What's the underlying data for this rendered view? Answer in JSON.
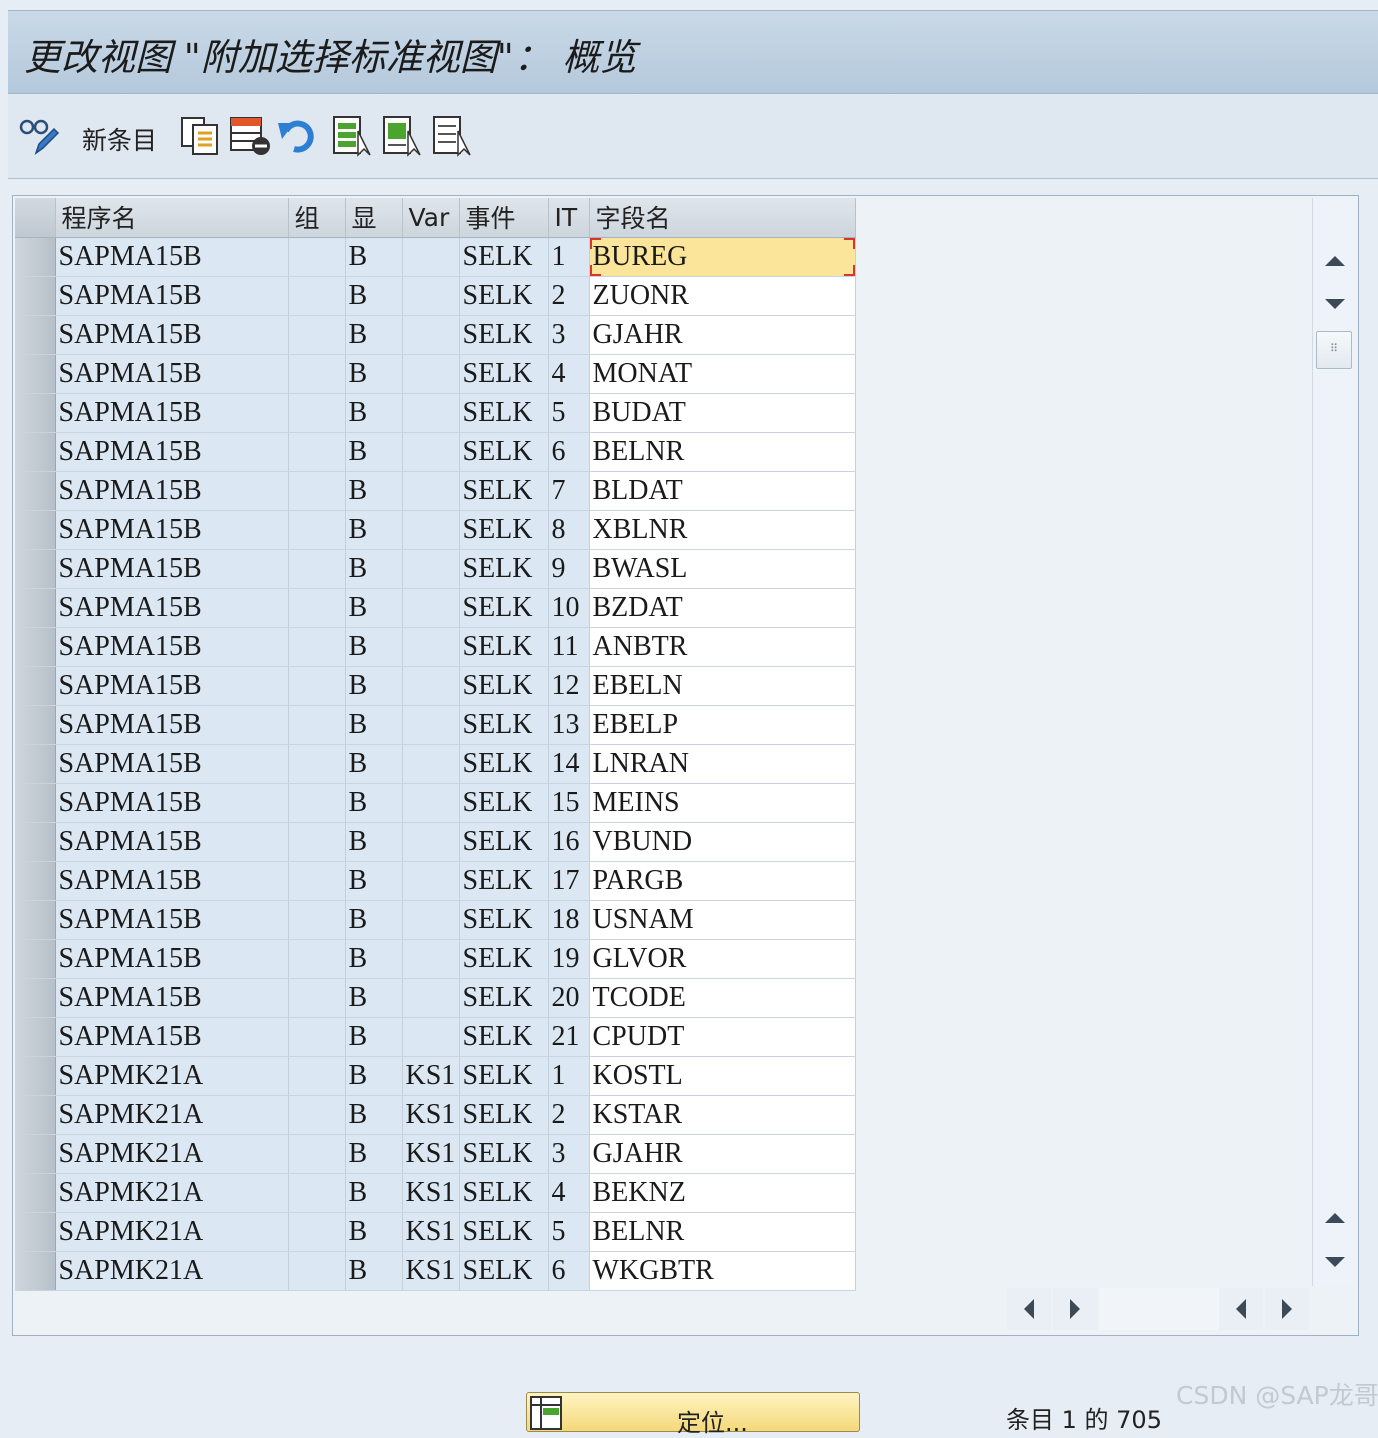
{
  "window": {
    "title": "更改视图 \"附加选择标准视图\"： 概览"
  },
  "toolbar": {
    "new_entry_label": "新条目",
    "icons": [
      "display-change-icon",
      "copy-icon",
      "delete-icon",
      "undo-icon",
      "select-all-icon",
      "select-block-icon",
      "deselect-all-icon"
    ]
  },
  "table": {
    "columns": [
      "程序名",
      "组",
      "显",
      "Var",
      "事件",
      "IT",
      "字段名"
    ],
    "rows": [
      {
        "program": "SAPMA15B",
        "group": "",
        "disp": "B",
        "var": "",
        "event": "SELK",
        "it": "1",
        "field": "BUREG"
      },
      {
        "program": "SAPMA15B",
        "group": "",
        "disp": "B",
        "var": "",
        "event": "SELK",
        "it": "2",
        "field": "ZUONR"
      },
      {
        "program": "SAPMA15B",
        "group": "",
        "disp": "B",
        "var": "",
        "event": "SELK",
        "it": "3",
        "field": "GJAHR"
      },
      {
        "program": "SAPMA15B",
        "group": "",
        "disp": "B",
        "var": "",
        "event": "SELK",
        "it": "4",
        "field": "MONAT"
      },
      {
        "program": "SAPMA15B",
        "group": "",
        "disp": "B",
        "var": "",
        "event": "SELK",
        "it": "5",
        "field": "BUDAT"
      },
      {
        "program": "SAPMA15B",
        "group": "",
        "disp": "B",
        "var": "",
        "event": "SELK",
        "it": "6",
        "field": "BELNR"
      },
      {
        "program": "SAPMA15B",
        "group": "",
        "disp": "B",
        "var": "",
        "event": "SELK",
        "it": "7",
        "field": "BLDAT"
      },
      {
        "program": "SAPMA15B",
        "group": "",
        "disp": "B",
        "var": "",
        "event": "SELK",
        "it": "8",
        "field": "XBLNR"
      },
      {
        "program": "SAPMA15B",
        "group": "",
        "disp": "B",
        "var": "",
        "event": "SELK",
        "it": "9",
        "field": "BWASL"
      },
      {
        "program": "SAPMA15B",
        "group": "",
        "disp": "B",
        "var": "",
        "event": "SELK",
        "it": "10",
        "field": "BZDAT"
      },
      {
        "program": "SAPMA15B",
        "group": "",
        "disp": "B",
        "var": "",
        "event": "SELK",
        "it": "11",
        "field": "ANBTR"
      },
      {
        "program": "SAPMA15B",
        "group": "",
        "disp": "B",
        "var": "",
        "event": "SELK",
        "it": "12",
        "field": "EBELN"
      },
      {
        "program": "SAPMA15B",
        "group": "",
        "disp": "B",
        "var": "",
        "event": "SELK",
        "it": "13",
        "field": "EBELP"
      },
      {
        "program": "SAPMA15B",
        "group": "",
        "disp": "B",
        "var": "",
        "event": "SELK",
        "it": "14",
        "field": "LNRAN"
      },
      {
        "program": "SAPMA15B",
        "group": "",
        "disp": "B",
        "var": "",
        "event": "SELK",
        "it": "15",
        "field": "MEINS"
      },
      {
        "program": "SAPMA15B",
        "group": "",
        "disp": "B",
        "var": "",
        "event": "SELK",
        "it": "16",
        "field": "VBUND"
      },
      {
        "program": "SAPMA15B",
        "group": "",
        "disp": "B",
        "var": "",
        "event": "SELK",
        "it": "17",
        "field": "PARGB"
      },
      {
        "program": "SAPMA15B",
        "group": "",
        "disp": "B",
        "var": "",
        "event": "SELK",
        "it": "18",
        "field": "USNAM"
      },
      {
        "program": "SAPMA15B",
        "group": "",
        "disp": "B",
        "var": "",
        "event": "SELK",
        "it": "19",
        "field": "GLVOR"
      },
      {
        "program": "SAPMA15B",
        "group": "",
        "disp": "B",
        "var": "",
        "event": "SELK",
        "it": "20",
        "field": "TCODE"
      },
      {
        "program": "SAPMA15B",
        "group": "",
        "disp": "B",
        "var": "",
        "event": "SELK",
        "it": "21",
        "field": "CPUDT"
      },
      {
        "program": "SAPMK21A",
        "group": "",
        "disp": "B",
        "var": "KS1",
        "event": "SELK",
        "it": "1",
        "field": "KOSTL"
      },
      {
        "program": "SAPMK21A",
        "group": "",
        "disp": "B",
        "var": "KS1",
        "event": "SELK",
        "it": "2",
        "field": "KSTAR"
      },
      {
        "program": "SAPMK21A",
        "group": "",
        "disp": "B",
        "var": "KS1",
        "event": "SELK",
        "it": "3",
        "field": "GJAHR"
      },
      {
        "program": "SAPMK21A",
        "group": "",
        "disp": "B",
        "var": "KS1",
        "event": "SELK",
        "it": "4",
        "field": "BEKNZ"
      },
      {
        "program": "SAPMK21A",
        "group": "",
        "disp": "B",
        "var": "KS1",
        "event": "SELK",
        "it": "5",
        "field": "BELNR"
      },
      {
        "program": "SAPMK21A",
        "group": "",
        "disp": "B",
        "var": "KS1",
        "event": "SELK",
        "it": "6",
        "field": "WKGBTR"
      }
    ]
  },
  "footer": {
    "position_button_label": "定位...",
    "entry_counter": "条目 1 的 705"
  },
  "watermark": "CSDN @SAP龙哥",
  "colors": {
    "title_bar": "#b4c9dc",
    "row_bg": "#dbe7f2",
    "focus_cell": "#fbe59a",
    "focus_marker": "#d8352c"
  }
}
